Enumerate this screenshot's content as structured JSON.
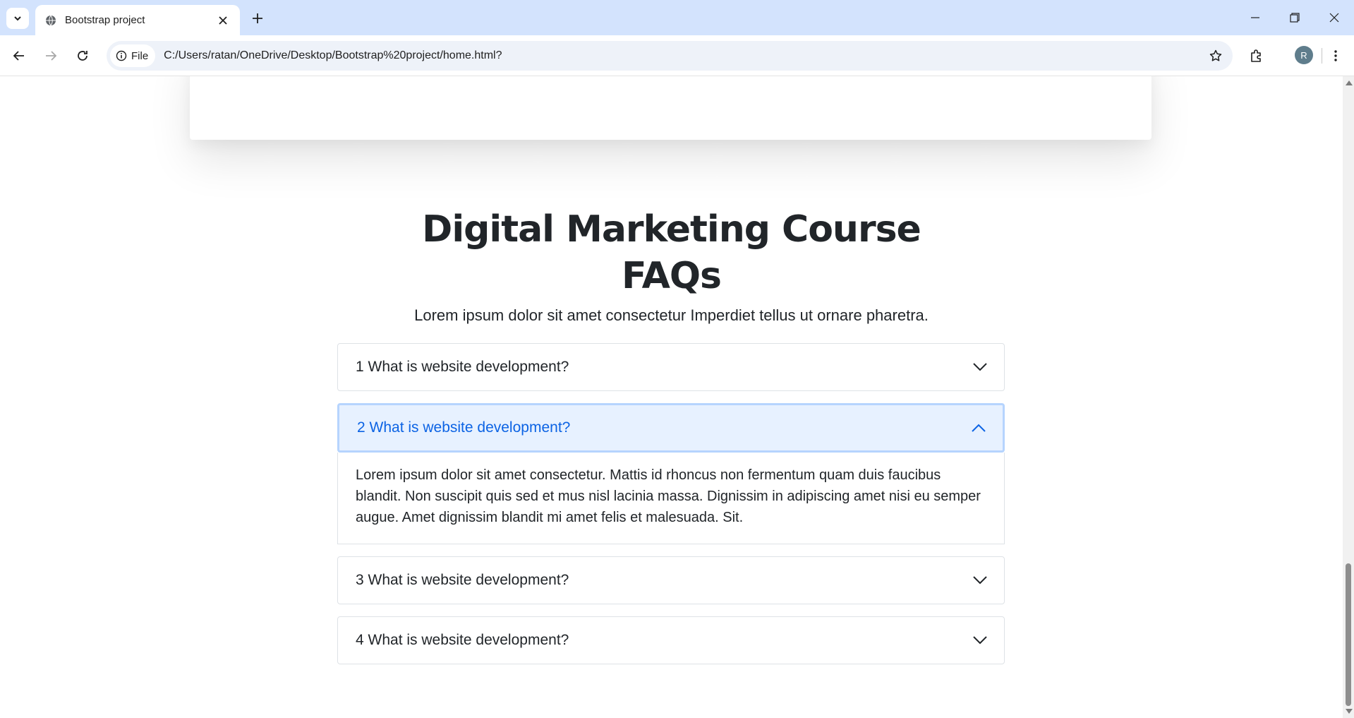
{
  "browser": {
    "tab_title": "Bootstrap project",
    "site_chip_label": "File",
    "url": "C:/Users/ratan/OneDrive/Desktop/Bootstrap%20project/home.html?",
    "avatar_letter": "R"
  },
  "faq": {
    "heading_line1": "Digital Marketing Course",
    "heading_line2": "FAQs",
    "subtitle": "Lorem ipsum dolor sit amet consectetur Imperdiet tellus ut ornare pharetra.",
    "items": [
      {
        "question": "1 What is website development?",
        "expanded": false
      },
      {
        "question": "2 What is website development?",
        "expanded": true,
        "answer": "Lorem ipsum dolor sit amet consectetur. Mattis id rhoncus non fermentum quam duis faucibus blandit. Non suscipit quis sed et mus nisl lacinia massa. Dignissim in adipiscing amet nisi eu semper augue. Amet dignissim blandit mi amet felis et malesuada. Sit."
      },
      {
        "question": "3 What is website development?",
        "expanded": false
      },
      {
        "question": "4 What is website development?",
        "expanded": false
      }
    ]
  },
  "colors": {
    "chrome_bg": "#d3e3fd",
    "accordion_active_bg": "#e7f1ff",
    "accordion_active_text": "#0c63e4"
  }
}
